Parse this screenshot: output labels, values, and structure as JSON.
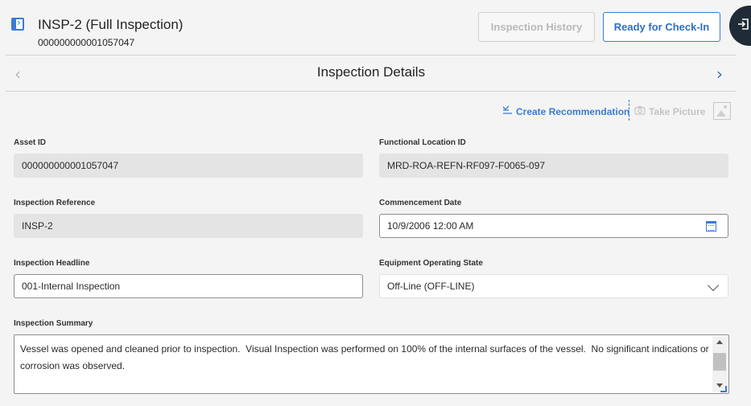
{
  "header": {
    "title": "INSP-2 (Full Inspection)",
    "subtitle": "000000000001057047",
    "history_button": "Inspection History",
    "checkin_button": "Ready for Check-In"
  },
  "section": {
    "title": "Inspection Details",
    "prev_icon": "chevron-left-icon",
    "next_icon": "chevron-right-icon"
  },
  "actions": {
    "create_recommendation": "Create Recommendation",
    "take_picture": "Take Picture"
  },
  "fields": {
    "asset_id": {
      "label": "Asset ID",
      "value": "000000000001057047"
    },
    "functional_location_id": {
      "label": "Functional Location ID",
      "value": "MRD-ROA-REFN-RF097-F0065-097"
    },
    "inspection_reference": {
      "label": "Inspection Reference",
      "value": "INSP-2"
    },
    "commencement_date": {
      "label": "Commencement Date",
      "value": "10/9/2006 12:00 AM"
    },
    "inspection_headline": {
      "label": "Inspection Headline",
      "value": "001-Internal Inspection"
    },
    "equipment_operating_state": {
      "label": "Equipment Operating State",
      "value": "Off-Line (OFF-LINE)"
    },
    "inspection_summary": {
      "label": "Inspection Summary",
      "value": "Vessel was opened and cleaned prior to inspection.  Visual Inspection was performed on 100% of the internal surfaces of the vessel.  No significant indications or corrosion was observed."
    }
  },
  "colors": {
    "accent": "#3a7bd5",
    "background": "#f4f4f4",
    "side_tab": "#1f2b36"
  }
}
